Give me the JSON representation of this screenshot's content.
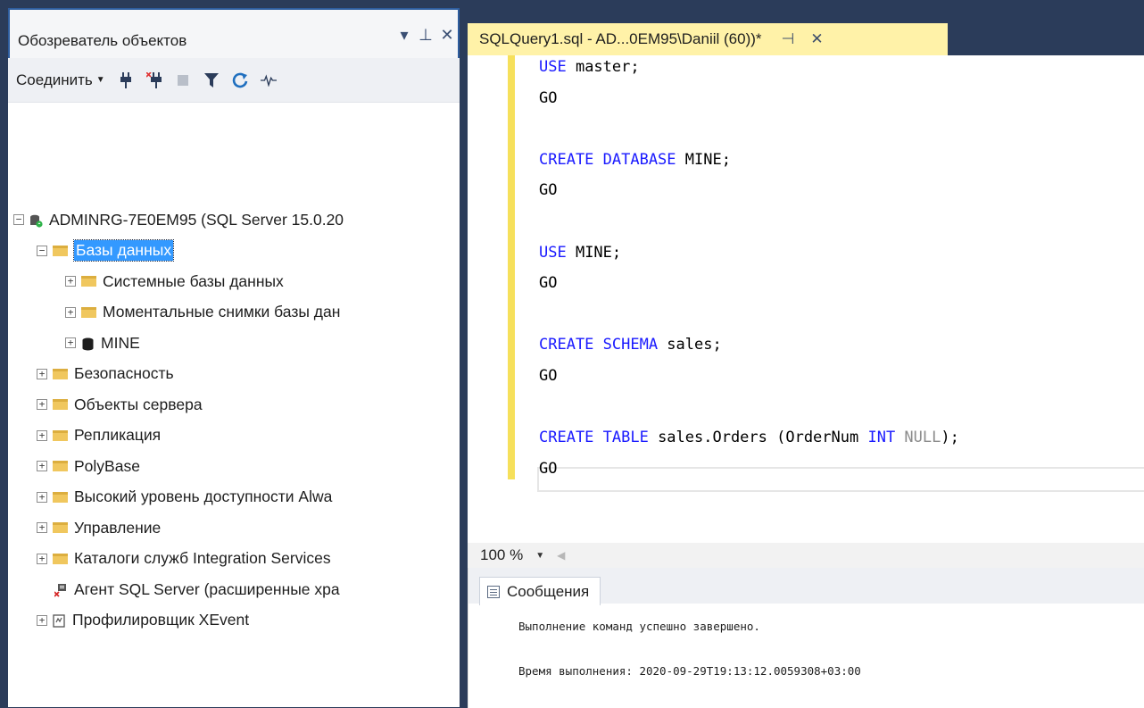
{
  "object_explorer": {
    "title": "Обозреватель объектов",
    "title_buttons": [
      "▾",
      "⊥",
      "✕"
    ],
    "connect_label": "Соединить",
    "tree": [
      {
        "label": "ADMINRG-7E0EM95 (SQL Server 15.0.20",
        "icon": "server-icon",
        "expander": "−",
        "indent": 0
      },
      {
        "label": "Базы данных",
        "icon": "folder-icon",
        "expander": "−",
        "indent": 1,
        "selected": true
      },
      {
        "label": "Системные базы данных",
        "icon": "folder-icon",
        "expander": "+",
        "indent": 2
      },
      {
        "label": "Моментальные снимки базы дан",
        "icon": "folder-icon",
        "expander": "+",
        "indent": 2
      },
      {
        "label": "MINE",
        "icon": "database-icon",
        "expander": "+",
        "indent": 2
      },
      {
        "label": "Безопасность",
        "icon": "folder-icon",
        "expander": "+",
        "indent": 1
      },
      {
        "label": "Объекты сервера",
        "icon": "folder-icon",
        "expander": "+",
        "indent": 1
      },
      {
        "label": "Репликация",
        "icon": "folder-icon",
        "expander": "+",
        "indent": 1
      },
      {
        "label": "PolyBase",
        "icon": "folder-icon",
        "expander": "+",
        "indent": 1
      },
      {
        "label": "Высокий уровень доступности Alwa",
        "icon": "folder-icon",
        "expander": "+",
        "indent": 1
      },
      {
        "label": "Управление",
        "icon": "folder-icon",
        "expander": "+",
        "indent": 1
      },
      {
        "label": "Каталоги служб Integration Services",
        "icon": "folder-icon",
        "expander": "+",
        "indent": 1
      },
      {
        "label": "Агент SQL Server (расширенные хра",
        "icon": "sql-agent-icon",
        "expander": "",
        "indent": 1
      },
      {
        "label": "Профилировщик XEvent",
        "icon": "xevent-profiler-icon",
        "expander": "+",
        "indent": 1
      }
    ]
  },
  "editor": {
    "tab_title": "SQLQuery1.sql - AD...0EM95\\Daniil (60))*",
    "tab_buttons": [
      "⊣",
      "✕"
    ],
    "code_lines": [
      [
        {
          "t": "USE ",
          "k": true
        },
        {
          "t": "master;",
          "k": false
        }
      ],
      [
        {
          "t": "GO",
          "k": false
        }
      ],
      [],
      [
        {
          "t": "CREATE DATABASE ",
          "k": true
        },
        {
          "t": "MINE;",
          "k": false
        }
      ],
      [
        {
          "t": "GO",
          "k": false
        }
      ],
      [],
      [
        {
          "t": "USE ",
          "k": true
        },
        {
          "t": "MINE;",
          "k": false
        }
      ],
      [
        {
          "t": "GO",
          "k": false
        }
      ],
      [],
      [
        {
          "t": "CREATE SCHEMA ",
          "k": true
        },
        {
          "t": "sales;",
          "k": false
        }
      ],
      [
        {
          "t": "GO",
          "k": false
        }
      ],
      [],
      [
        {
          "t": "CREATE TABLE ",
          "k": true
        },
        {
          "t": "sales.Orders (OrderNum ",
          "k": false
        },
        {
          "t": "INT ",
          "k": true
        },
        {
          "t": "NULL",
          "g": true
        },
        {
          "t": ");",
          "k": false
        }
      ],
      [
        {
          "t": "GO",
          "k": false
        }
      ]
    ],
    "zoom": "100 %"
  },
  "results": {
    "tab_label": "Сообщения",
    "messages": [
      "Выполнение команд успешно завершено.",
      "Время выполнения: 2020-09-29T19:13:12.0059308+03:00"
    ]
  },
  "colors": {
    "keyword": "#1a1aff",
    "selection": "#3399ff",
    "tab_active": "#fff2a8",
    "chrome": "#2b3c5a"
  }
}
